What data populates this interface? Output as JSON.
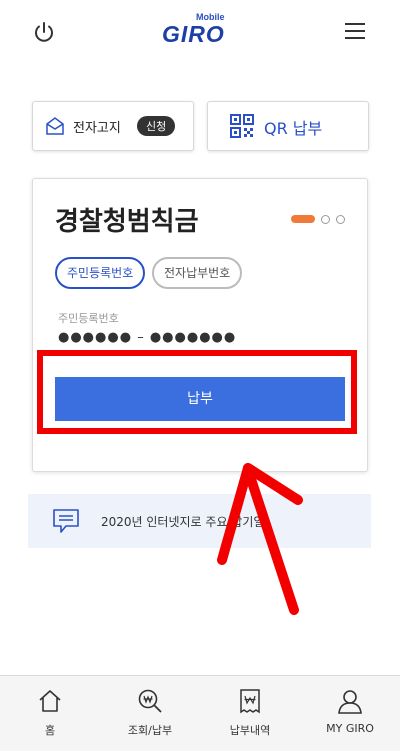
{
  "header": {
    "logo_small": "Mobile",
    "logo_main": "GIRO",
    "power_icon": "power-icon",
    "menu_icon": "hamburger-menu-icon"
  },
  "top_buttons": {
    "e_invoice": {
      "label": "전자고지",
      "badge": "신청",
      "icon": "envelope-icon"
    },
    "qr_pay": {
      "label": "QR 납부",
      "icon": "qr-code-icon"
    }
  },
  "card": {
    "title": "경찰청범칙금",
    "tabs": [
      "주민등록번호",
      "전자납부번호"
    ],
    "selected_tab": "주민등록번호",
    "field_label": "주민등록번호",
    "field_value": "●●●●●● – ●●●●●●●",
    "pay_button": "납부",
    "pager": {
      "pages": 3,
      "active": 1
    }
  },
  "notice": {
    "text": "2020년 인터넷지로 주요 납기일",
    "icon": "chat-notice-icon"
  },
  "bottom_nav": [
    {
      "label": "홈",
      "icon": "home-icon"
    },
    {
      "label": "조회/납부",
      "icon": "won-search-icon"
    },
    {
      "label": "납부내역",
      "icon": "receipt-icon"
    },
    {
      "label": "MY GIRO",
      "icon": "user-icon"
    }
  ],
  "colors": {
    "accent": "#3b6fe0",
    "brand": "#1d3fa8",
    "pager_active": "#f07a3a",
    "highlight": "#f20000"
  }
}
